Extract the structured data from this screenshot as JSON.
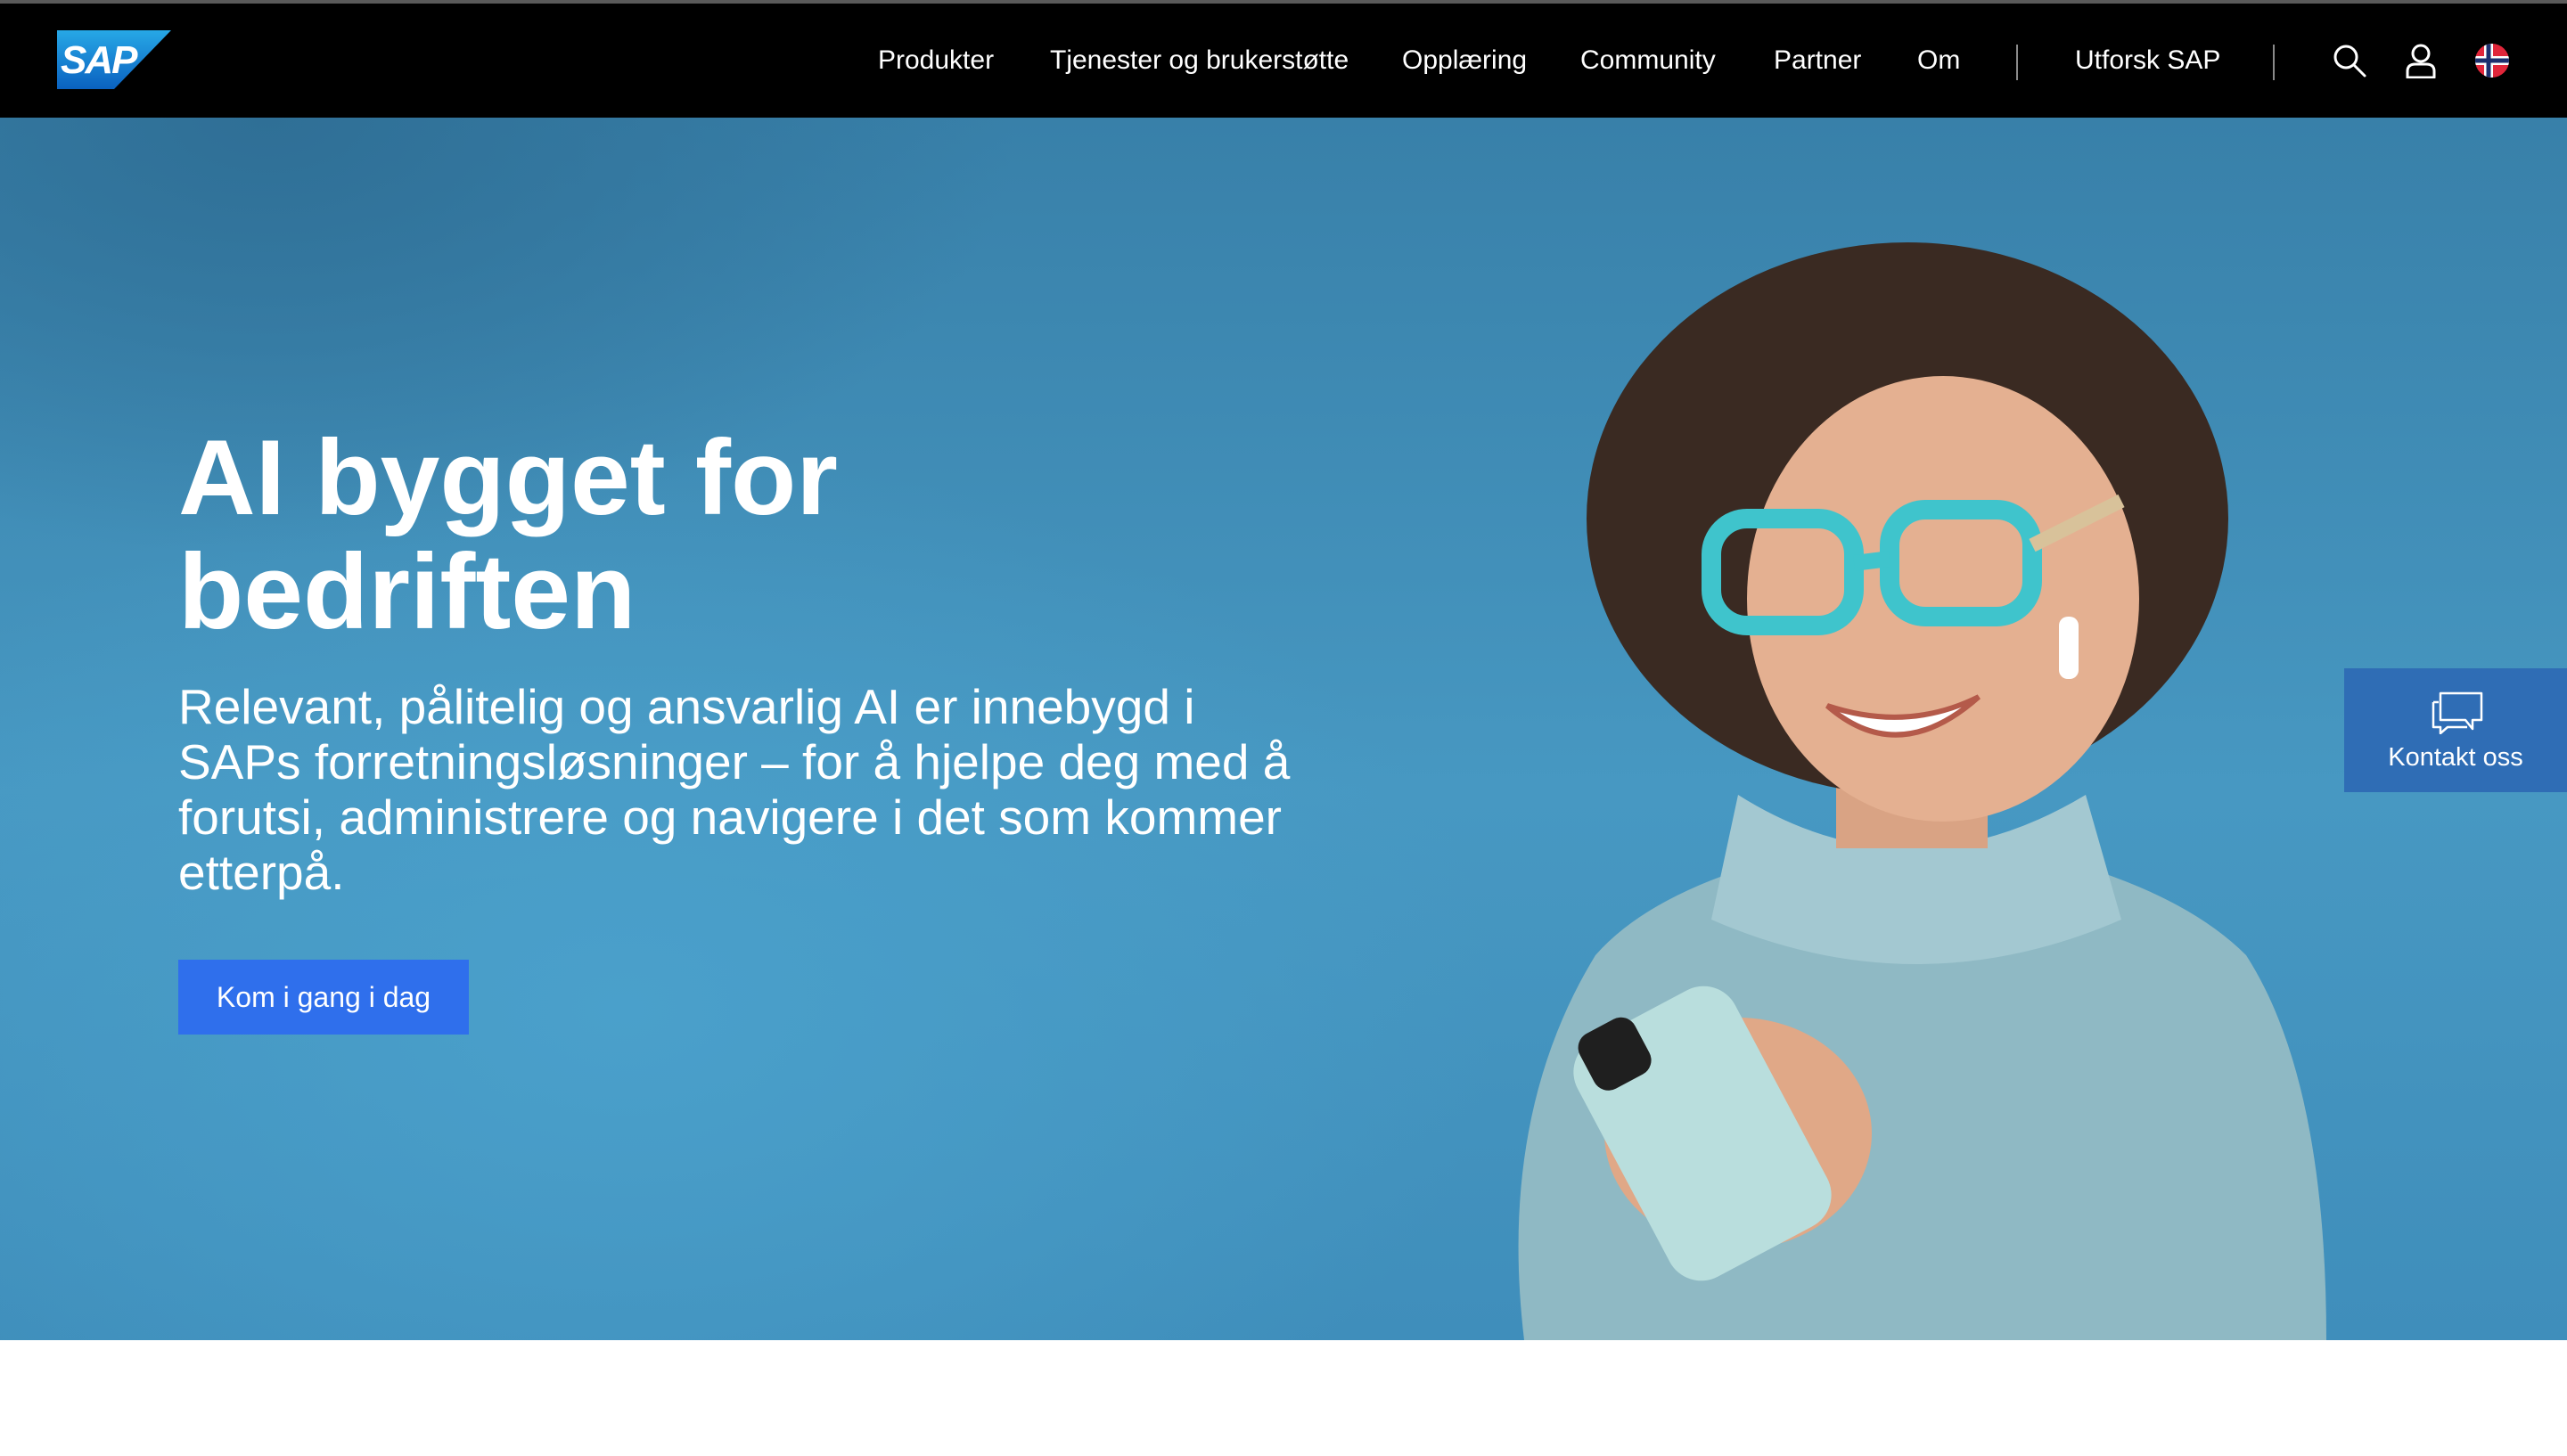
{
  "header": {
    "logo_text": "SAP",
    "nav": [
      {
        "label": "Produkter"
      },
      {
        "label": "Tjenester og brukerstøtte"
      },
      {
        "label": "Opplæring"
      },
      {
        "label": "Community"
      },
      {
        "label": "Partner"
      },
      {
        "label": "Om"
      }
    ],
    "explore_label": "Utforsk SAP",
    "icons": [
      "search-icon",
      "user-icon",
      "norway-flag-icon"
    ]
  },
  "hero": {
    "title_line1": "AI bygget for",
    "title_line2": "bedriften",
    "subtitle": "Relevant, pålitelig og ansvarlig AI er innebygd i SAPs forretningsløsninger – for å hjelpe deg med å forutsi, administrere og navigere i det som kommer etterpå.",
    "cta_label": "Kom i gang i dag"
  },
  "contact": {
    "label": "Kontakt oss",
    "icon": "chat-bubbles-icon"
  },
  "colors": {
    "header_bg": "#000000",
    "hero_blue": "#4798c2",
    "cta_blue": "#2f6fec",
    "contact_blue": "#2f6db5",
    "logo_blue": "#1f7fd4"
  }
}
